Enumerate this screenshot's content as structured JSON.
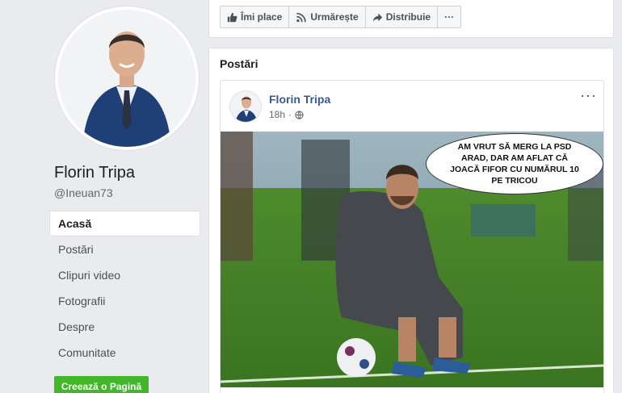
{
  "page": {
    "name": "Florin Tripa",
    "handle": "@Ineuan73"
  },
  "nav": [
    {
      "label": "Acasă",
      "active": true
    },
    {
      "label": "Postări"
    },
    {
      "label": "Clipuri video"
    },
    {
      "label": "Fotografii"
    },
    {
      "label": "Despre"
    },
    {
      "label": "Comunitate"
    }
  ],
  "create_page_label": "Creează o Pagină",
  "actions": {
    "like": "Îmi place",
    "follow": "Urmărește",
    "share": "Distribuie",
    "more": "···"
  },
  "posts": {
    "title": "Postări",
    "post": {
      "author": "Florin Tripa",
      "time": "18h",
      "privacy_icon": "globe-icon",
      "more": "···",
      "image_caption": "AM VRUT SĂ MERG LA PSD ARAD, DAR AM AFLAT CĂ JOACĂ FIFOR CU NUMĂRUL 10 PE TRICOU"
    }
  },
  "colors": {
    "link": "#385898",
    "green": "#42b72a",
    "background": "#e9ebee"
  }
}
